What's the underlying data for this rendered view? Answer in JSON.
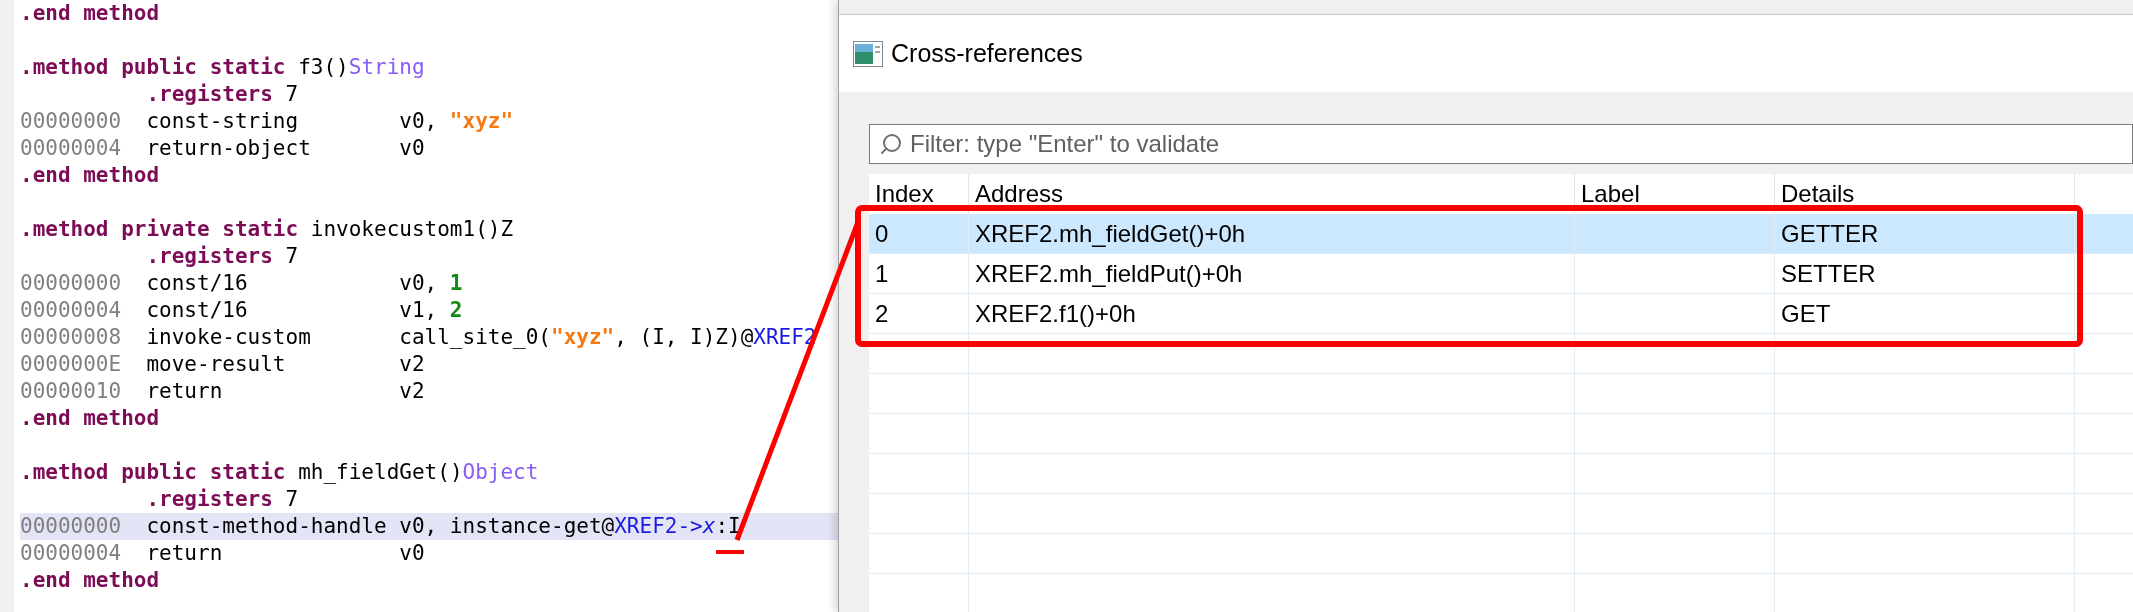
{
  "code_lines": [
    {
      "kind": "header",
      "selected": false,
      "tokens": [
        {
          "text": ".end method",
          "kind": "keyword"
        }
      ]
    },
    {
      "kind": "blank",
      "selected": false
    },
    {
      "kind": "header",
      "selected": false,
      "tokens": [
        {
          "text": ".method public static",
          "kind": "keyword"
        },
        {
          "text": " f3()",
          "kind": "plain"
        },
        {
          "text": "String",
          "kind": "type"
        }
      ]
    },
    {
      "kind": "directive",
      "selected": false,
      "tokens": [
        {
          "text": ".registers",
          "kind": "keyword"
        },
        {
          "text": " 7",
          "kind": "plain"
        }
      ]
    },
    {
      "kind": "instruction",
      "selected": false,
      "address": "00000000",
      "opcode": "const-string",
      "tokens": [
        {
          "text": "v0, ",
          "kind": "plain"
        },
        {
          "text": "\"xyz\"",
          "kind": "string"
        }
      ]
    },
    {
      "kind": "instruction",
      "selected": false,
      "address": "00000004",
      "opcode": "return-object",
      "tokens": [
        {
          "text": "v0",
          "kind": "plain"
        }
      ]
    },
    {
      "kind": "header",
      "selected": false,
      "tokens": [
        {
          "text": ".end method",
          "kind": "keyword"
        }
      ]
    },
    {
      "kind": "blank",
      "selected": false
    },
    {
      "kind": "header",
      "selected": false,
      "tokens": [
        {
          "text": ".method private static",
          "kind": "keyword"
        },
        {
          "text": " invokecustom1()Z",
          "kind": "plain"
        }
      ]
    },
    {
      "kind": "directive",
      "selected": false,
      "tokens": [
        {
          "text": ".registers",
          "kind": "keyword"
        },
        {
          "text": " 7",
          "kind": "plain"
        }
      ]
    },
    {
      "kind": "instruction",
      "selected": false,
      "address": "00000000",
      "opcode": "const/16",
      "tokens": [
        {
          "text": "v0, ",
          "kind": "plain"
        },
        {
          "text": "1",
          "kind": "number"
        }
      ]
    },
    {
      "kind": "instruction",
      "selected": false,
      "address": "00000004",
      "opcode": "const/16",
      "tokens": [
        {
          "text": "v1, ",
          "kind": "plain"
        },
        {
          "text": "2",
          "kind": "number"
        }
      ]
    },
    {
      "kind": "instruction",
      "selected": false,
      "address": "00000008",
      "opcode": "invoke-custom",
      "tokens": [
        {
          "text": "call_site_0(",
          "kind": "plain"
        },
        {
          "text": "\"xyz\"",
          "kind": "string"
        },
        {
          "text": ", (I, I)Z)@",
          "kind": "plain"
        },
        {
          "text": "XREF2",
          "kind": "link"
        }
      ]
    },
    {
      "kind": "instruction",
      "selected": false,
      "address": "0000000E",
      "opcode": "move-result",
      "tokens": [
        {
          "text": "v2",
          "kind": "plain"
        }
      ]
    },
    {
      "kind": "instruction",
      "selected": false,
      "address": "00000010",
      "opcode": "return",
      "tokens": [
        {
          "text": "v2",
          "kind": "plain"
        }
      ]
    },
    {
      "kind": "header",
      "selected": false,
      "tokens": [
        {
          "text": ".end method",
          "kind": "keyword"
        }
      ]
    },
    {
      "kind": "blank",
      "selected": false
    },
    {
      "kind": "header",
      "selected": false,
      "tokens": [
        {
          "text": ".method public static",
          "kind": "keyword"
        },
        {
          "text": " mh_fieldGet()",
          "kind": "plain"
        },
        {
          "text": "Object",
          "kind": "type"
        }
      ]
    },
    {
      "kind": "directive",
      "selected": false,
      "tokens": [
        {
          "text": ".registers",
          "kind": "keyword"
        },
        {
          "text": " 7",
          "kind": "plain"
        }
      ]
    },
    {
      "kind": "instruction",
      "selected": true,
      "address": "00000000",
      "opcode": "const-method-handle",
      "tokens": [
        {
          "text": "v0, instance-get@",
          "kind": "plain"
        },
        {
          "text": "XREF2->",
          "kind": "link"
        },
        {
          "text": "x",
          "kind": "field"
        },
        {
          "text": ":I",
          "kind": "plain"
        }
      ]
    },
    {
      "kind": "instruction",
      "selected": false,
      "address": "00000004",
      "opcode": "return",
      "tokens": [
        {
          "text": "v0",
          "kind": "plain"
        }
      ]
    },
    {
      "kind": "header",
      "selected": false,
      "tokens": [
        {
          "text": ".end method",
          "kind": "keyword"
        }
      ]
    }
  ],
  "dialog": {
    "title": "Cross-references",
    "filter": {
      "placeholder": "Filter: type \"Enter\" to validate"
    },
    "table": {
      "columns": [
        "Index",
        "Address",
        "Label",
        "Details"
      ],
      "rows": [
        {
          "index": "0",
          "address": "XREF2.mh_fieldGet()+0h",
          "details": "GETTER",
          "selected": true
        },
        {
          "index": "1",
          "address": "XREF2.mh_fieldPut()+0h",
          "details": "SETTER",
          "selected": false
        },
        {
          "index": "2",
          "address": "XREF2.f1()+0h",
          "details": "GET",
          "selected": false
        }
      ]
    }
  }
}
